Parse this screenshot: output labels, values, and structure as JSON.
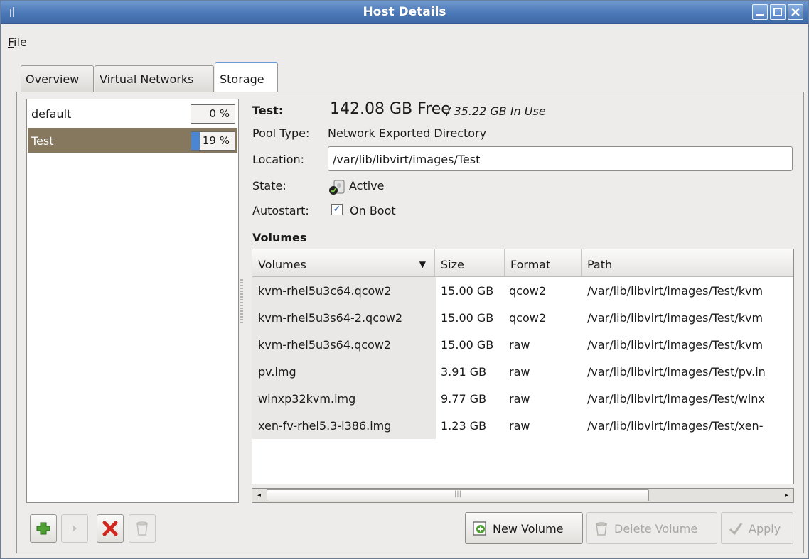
{
  "window": {
    "title": "Host Details"
  },
  "menu": {
    "file_prefix": "F",
    "file_rest": "ile"
  },
  "tabs": [
    {
      "label": "Overview"
    },
    {
      "label": "Virtual Networks"
    },
    {
      "label": "Storage"
    }
  ],
  "pools": [
    {
      "name": "default",
      "usage": "0 %",
      "fill_fraction": 0.0
    },
    {
      "name": "Test",
      "usage": "19 %",
      "fill_fraction": 0.19
    }
  ],
  "details": {
    "pool_label": "Test:",
    "free": "142.08 GB Free",
    "in_use": "/ 35.22 GB In Use",
    "pool_type_label": "Pool Type:",
    "pool_type": "Network Exported Directory",
    "location_label": "Location:",
    "location": "/var/lib/libvirt/images/Test",
    "state_label": "State:",
    "state": "Active",
    "autostart_label": "Autostart:",
    "autostart": "On Boot",
    "autostart_checked": true
  },
  "volumes": {
    "heading": "Volumes",
    "columns": [
      "Volumes",
      "Size",
      "Format",
      "Path"
    ],
    "rows": [
      [
        "kvm-rhel5u3c64.qcow2",
        "15.00 GB",
        "qcow2",
        "/var/lib/libvirt/images/Test/kvm"
      ],
      [
        "kvm-rhel5u3s64-2.qcow2",
        "15.00 GB",
        "qcow2",
        "/var/lib/libvirt/images/Test/kvm"
      ],
      [
        "kvm-rhel5u3s64.qcow2",
        "15.00 GB",
        "raw",
        "/var/lib/libvirt/images/Test/kvm"
      ],
      [
        "pv.img",
        "3.91 GB",
        "raw",
        "/var/lib/libvirt/images/Test/pv.in"
      ],
      [
        "winxp32kvm.img",
        "9.77 GB",
        "raw",
        "/var/lib/libvirt/images/Test/winx"
      ],
      [
        "xen-fv-rhel5.3-i386.img",
        "1.23 GB",
        "raw",
        "/var/lib/libvirt/images/Test/xen-"
      ]
    ]
  },
  "buttons": {
    "new_volume": "New Volume",
    "delete_volume": "Delete Volume",
    "apply": "Apply"
  },
  "colors": {
    "titlebar": "#4b78b7",
    "selection": "#86775f",
    "usage_fill": "#4a86d4",
    "window_bg": "#edeceb"
  }
}
